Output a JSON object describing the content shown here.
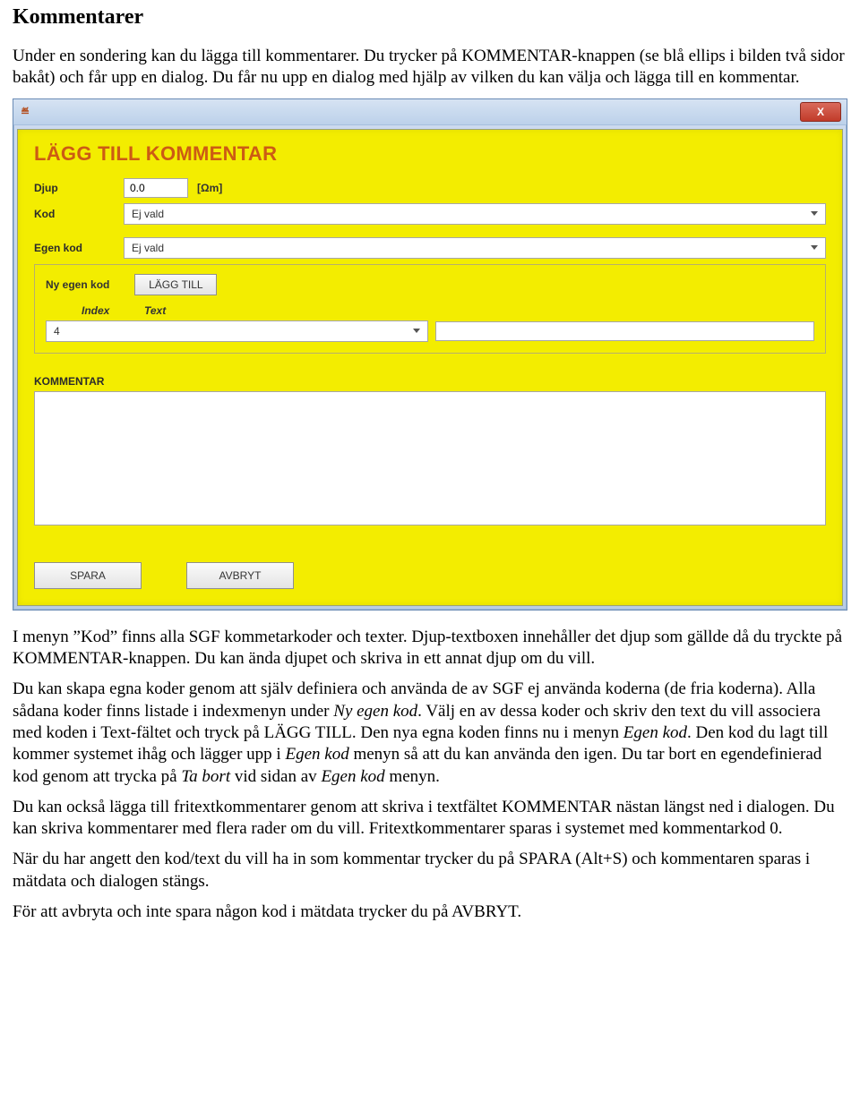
{
  "doc": {
    "title": "Kommentarer",
    "p1": "Under en sondering kan du lägga till kommentarer. Du trycker på KOMMENTAR-knappen (se blå ellips i bilden två sidor bakåt) och får upp en dialog. Du får nu upp en dialog med hjälp av vilken du kan välja och lägga till en kommentar.",
    "p2a": "I menyn ”Kod” finns alla SGF kommetarkoder och texter. Djup-textboxen innehåller det djup som gällde då du tryckte på KOMMENTAR-knappen. Du kan ända djupet och skriva in ett annat djup om du vill.",
    "p3a": "Du kan skapa egna koder genom att själv definiera och använda de av SGF ej använda koderna (de fria koderna). Alla sådana koder finns listade i indexmenyn under ",
    "p3b_italic": "Ny egen kod",
    "p3c": ". Välj en av dessa koder och skriv den text du vill associera med koden i Text-fältet och tryck på LÄGG TILL. Den nya egna koden finns nu i menyn ",
    "p3d_italic": "Egen kod",
    "p3e": ". Den kod du lagt till kommer systemet ihåg och lägger upp i ",
    "p3f_italic": "Egen kod",
    "p3g": " menyn så att du kan använda den igen. Du tar bort en egendefinierad kod genom att trycka på ",
    "p3h_italic": "Ta bort",
    "p3i": " vid sidan av ",
    "p3j_italic": "Egen kod",
    "p3k": " menyn.",
    "p4": "Du kan också lägga till fritextkommentarer genom att skriva i textfältet KOMMENTAR nästan längst ned i dialogen. Du kan skriva kommentarer med flera rader om du vill. Fritextkommentarer sparas i systemet med kommentarkod 0.",
    "p5": "När du har angett den kod/text du vill ha in som kommentar trycker du på SPARA (Alt+S) och kommentaren sparas i mätdata och dialogen stängs.",
    "p6": "För att avbryta och inte spara någon kod i mätdata trycker du på AVBRYT."
  },
  "dialog": {
    "java_badge": "≝",
    "close_x": "X",
    "title": "LÄGG TILL KOMMENTAR",
    "labels": {
      "djup": "Djup",
      "kod": "Kod",
      "egen_kod": "Egen kod",
      "ny_egen_kod": "Ny egen kod",
      "index": "Index",
      "text": "Text",
      "kommentar": "KOMMENTAR"
    },
    "values": {
      "djup": "0.0",
      "unit": "[Ωm]",
      "kod_selected": "Ej vald",
      "egen_kod_selected": "Ej vald",
      "index_selected": "4",
      "text_value": "",
      "kommentar_value": ""
    },
    "buttons": {
      "lagg_till": "LÄGG TILL",
      "spara": "SPARA",
      "avbryt": "AVBRYT"
    }
  }
}
